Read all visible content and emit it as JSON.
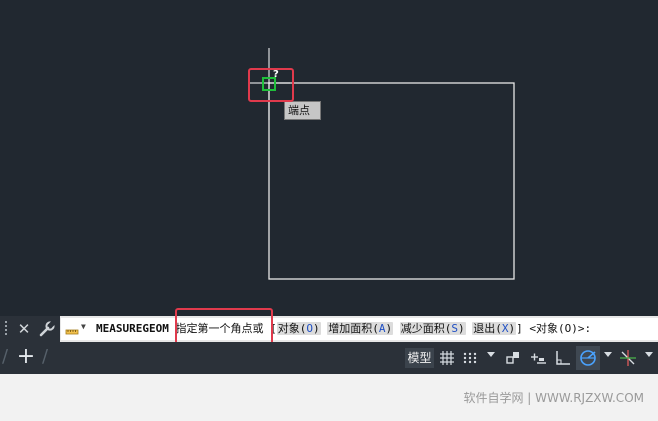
{
  "canvas": {
    "background": "#212830",
    "snap_tooltip": "端点",
    "cursor_hint": "?"
  },
  "command_line": {
    "command": "MEASUREGEOM",
    "prompt": "指定第一个角点或",
    "options": [
      {
        "label": "对象",
        "key": "O"
      },
      {
        "label": "增加面积",
        "key": "A"
      },
      {
        "label": "减少面积",
        "key": "S"
      },
      {
        "label": "退出",
        "key": "X"
      }
    ],
    "default": "<对象(O)>:"
  },
  "status_bar": {
    "model_label": "模型",
    "icons": [
      "grid-icon",
      "snap-mode-icon",
      "infer-constraints-icon",
      "dynamic-input-icon",
      "ortho-icon",
      "polar-tracking-icon",
      "object-snap-tracking-icon"
    ]
  },
  "watermark": "软件自学网 | WWW.RJZXW.COM",
  "colors": {
    "highlight": "#e03a4c",
    "snap_marker": "#1fbf3a",
    "accent_blue": "#4aa3ff"
  }
}
